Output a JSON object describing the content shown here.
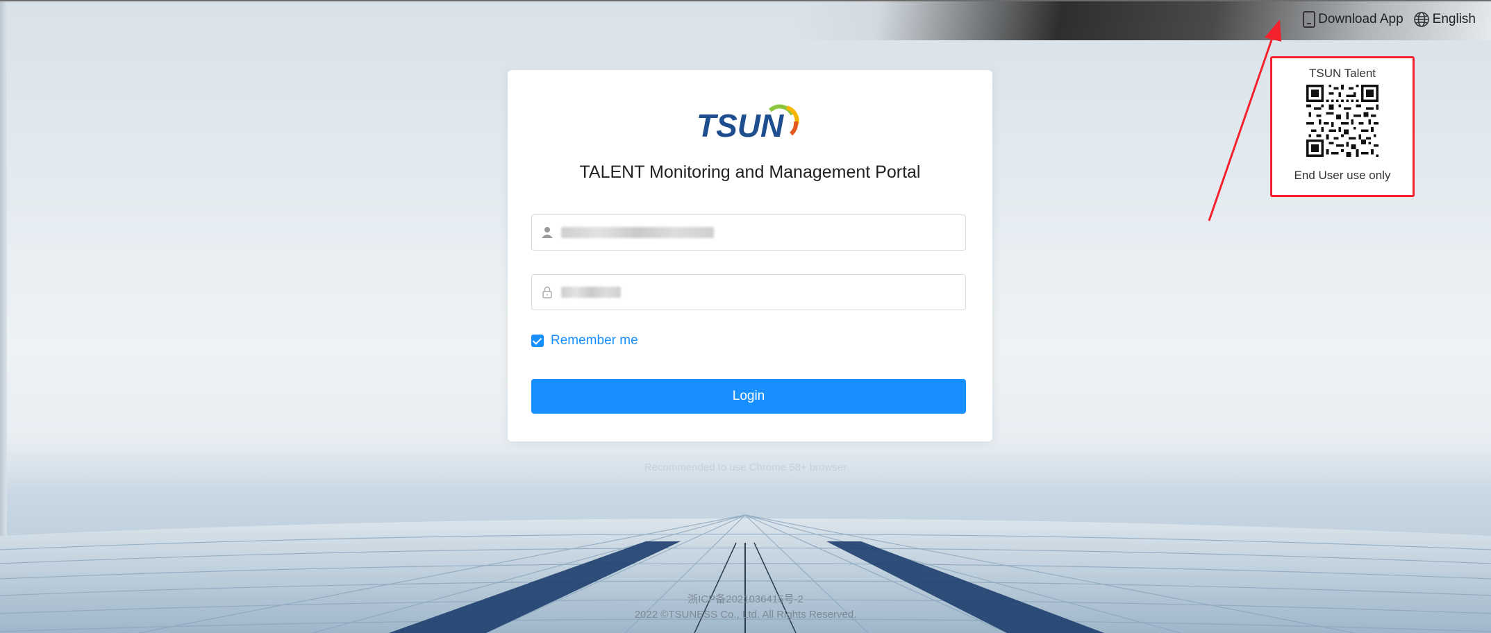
{
  "header": {
    "download_label": "Download App",
    "language_label": "English"
  },
  "qr_popover": {
    "title": "TSUN Talent",
    "footer": "End User use only"
  },
  "login": {
    "logo_text": "TSUN",
    "title": "TALENT Monitoring and Management Portal",
    "remember_label": "Remember me",
    "remember_checked": true,
    "login_label": "Login"
  },
  "recommend": "Recommended to use Chrome 58+ browser",
  "footer": {
    "icp": "浙ICP备2021036415号-2",
    "copyright": "2022 ©TSUNESS Co., Ltd. All Rights Reserved."
  },
  "colors": {
    "primary": "#1890ff",
    "highlight": "#f5222d",
    "logo_blue": "#1f4e8f"
  }
}
